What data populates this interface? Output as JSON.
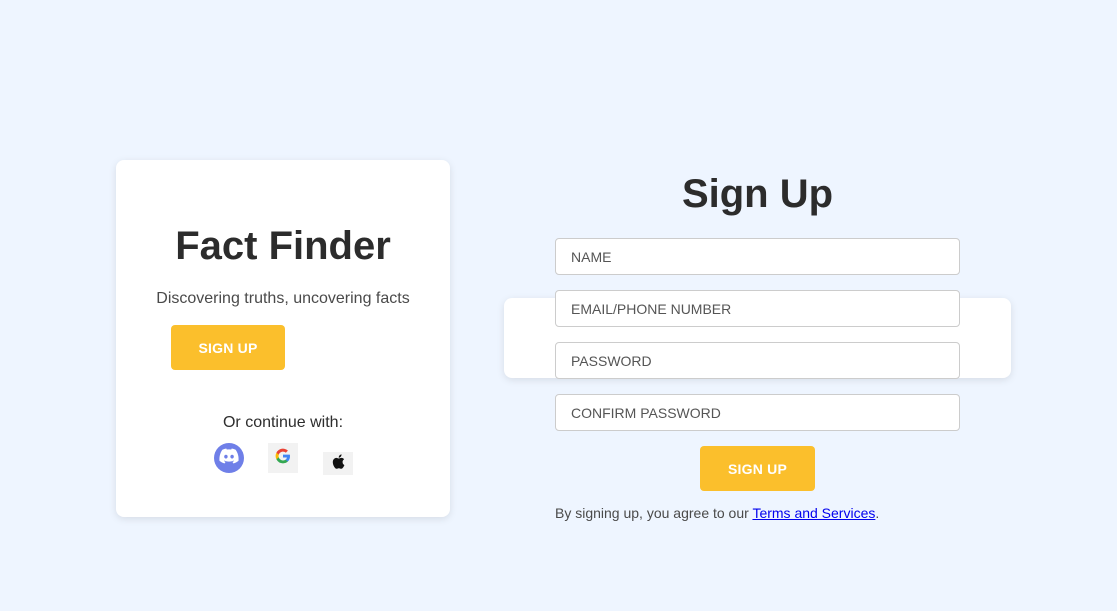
{
  "brand": {
    "title": "Fact Finder",
    "tagline": "Discovering truths, uncovering facts",
    "signup_label": "SIGN UP",
    "continue_text": "Or continue with:",
    "social": [
      {
        "name": "Discord",
        "icon": "discord-icon",
        "color": "#6f7fe8"
      },
      {
        "name": "Google",
        "icon": "google-icon",
        "color": "#f2f2f2"
      },
      {
        "name": "Apple",
        "icon": "apple-icon",
        "color": "#f2f2f2"
      }
    ]
  },
  "form": {
    "title": "Sign Up",
    "fields": {
      "name_placeholder": "NAME",
      "email_placeholder": "EMAIL/PHONE NUMBER",
      "password_placeholder": "PASSWORD",
      "confirm_placeholder": "CONFIRM PASSWORD"
    },
    "submit_label": "SIGN UP",
    "terms_prefix": "By signing up, you agree to our ",
    "terms_link": "Terms and Services",
    "terms_suffix": "."
  },
  "colors": {
    "background": "#eef5ff",
    "accent": "#fbbf2c",
    "link": "#0000ee"
  }
}
